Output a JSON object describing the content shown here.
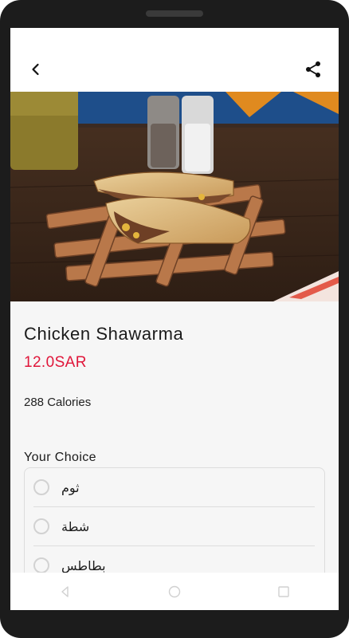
{
  "appbar": {
    "back_icon": "back-arrow-icon",
    "share_icon": "share-icon"
  },
  "product": {
    "name": "Chicken Shawarma",
    "price": "12.0SAR",
    "calories": "288 Calories"
  },
  "options": {
    "section_title": "Your Choice",
    "items": [
      {
        "label": "ثوم",
        "selected": false
      },
      {
        "label": "شطة",
        "selected": false
      },
      {
        "label": "بطاطس",
        "selected": false
      }
    ]
  },
  "navigation": {
    "back_icon": "nav-back-icon",
    "home_icon": "nav-home-icon",
    "recents_icon": "nav-recents-icon"
  },
  "colors": {
    "price": "#e0163a",
    "background": "#f6f6f6",
    "device_frame": "#1c1c1c"
  }
}
